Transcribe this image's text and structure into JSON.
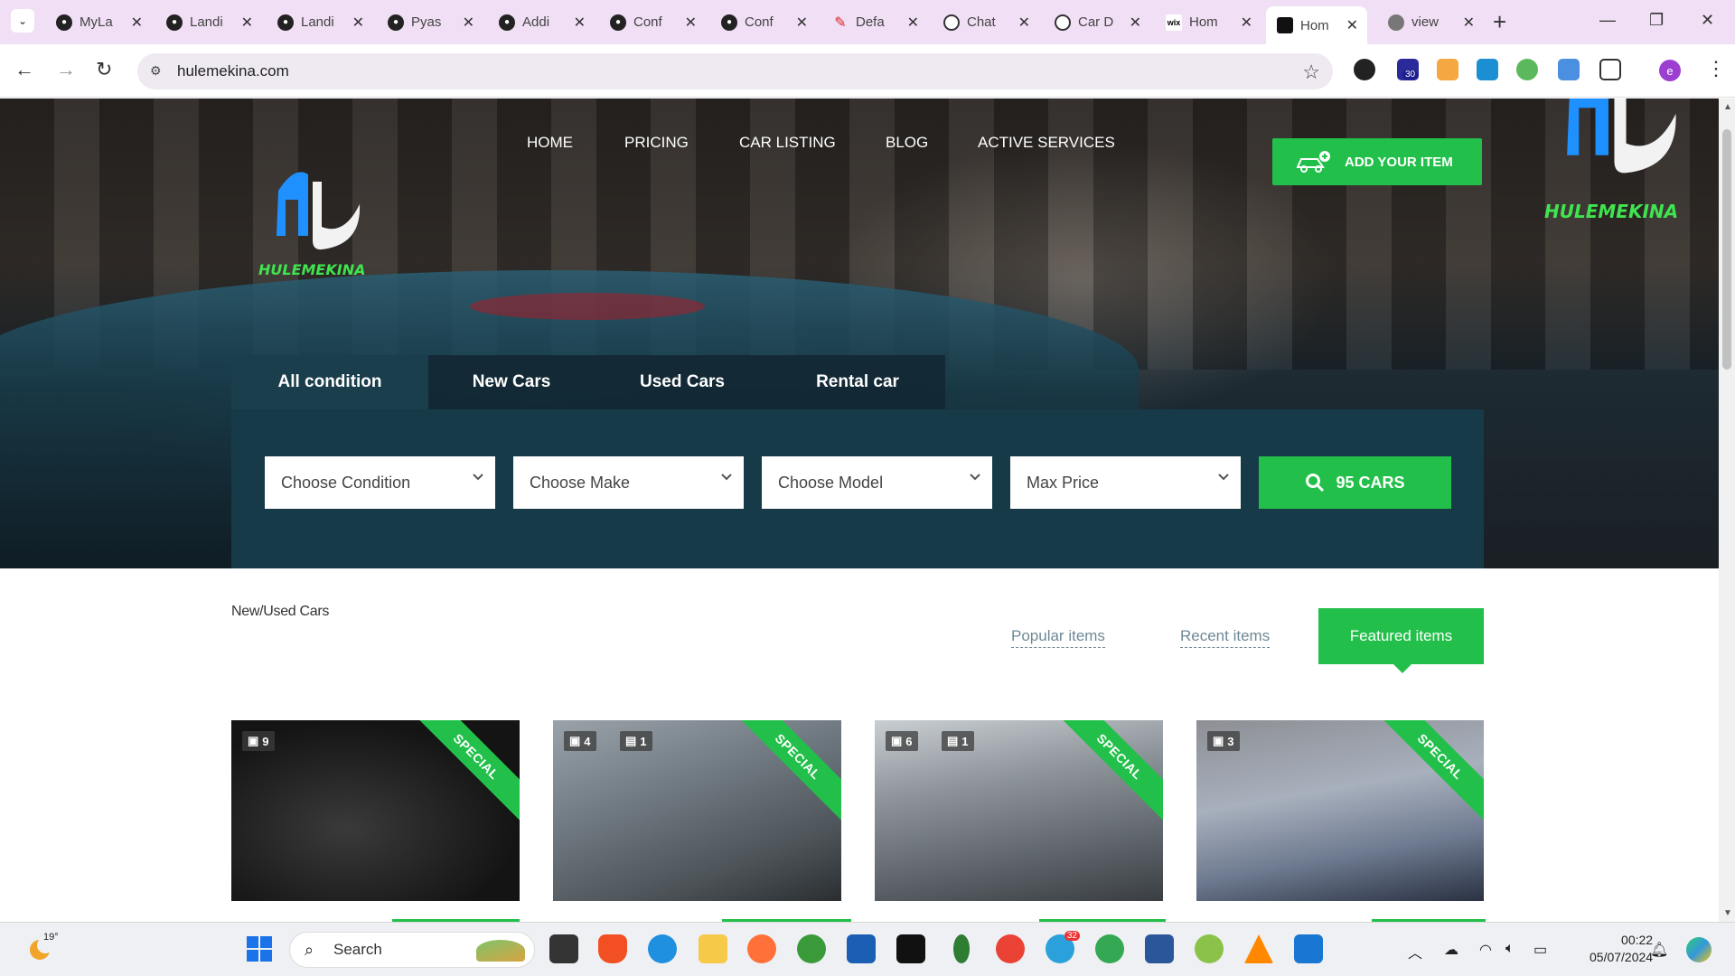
{
  "browser": {
    "tabs": [
      {
        "title": "MyLa",
        "icon": "github-icon"
      },
      {
        "title": "Landi",
        "icon": "github-icon"
      },
      {
        "title": "Landi",
        "icon": "github-icon"
      },
      {
        "title": "Pyas",
        "icon": "github-icon"
      },
      {
        "title": "Addi",
        "icon": "github-icon"
      },
      {
        "title": "Conf",
        "icon": "github-icon"
      },
      {
        "title": "Conf",
        "icon": "github-icon"
      },
      {
        "title": "Defa",
        "icon": "pen-icon"
      },
      {
        "title": "Chat",
        "icon": "openai-icon"
      },
      {
        "title": "Car D",
        "icon": "openai-icon"
      },
      {
        "title": "Hom",
        "icon": "wix-icon"
      },
      {
        "title": "Hom",
        "icon": "hulemekina-icon",
        "active": true
      },
      {
        "title": "view",
        "icon": "globe-icon"
      }
    ],
    "url": "hulemekina.com",
    "extension_badge": "30",
    "profile_initial": "e"
  },
  "site": {
    "brand_name": "HULEMEKINA",
    "nav": [
      "HOME",
      "PRICING",
      "CAR LISTING",
      "BLOG",
      "ACTIVE SERVICES"
    ],
    "add_item_label": "ADD YOUR ITEM",
    "search_tabs": [
      "All condition",
      "New Cars",
      "Used Cars",
      "Rental car"
    ],
    "active_search_tab": "All condition",
    "selects": [
      "Choose Condition",
      "Choose Make",
      "Choose Model",
      "Max Price"
    ],
    "search_button_label": "95 CARS",
    "section_title": "New/Used Cars",
    "filters": [
      "Popular items",
      "Recent items",
      "Featured items"
    ],
    "active_filter": "Featured items",
    "ribbon_label": "SPECIAL",
    "listings": [
      {
        "photos": "9",
        "videos": null
      },
      {
        "photos": "4",
        "videos": "1"
      },
      {
        "photos": "6",
        "videos": "1"
      },
      {
        "photos": "3",
        "videos": null
      }
    ]
  },
  "colors": {
    "accent_green": "#22c04a",
    "brand_blue": "#1e90ff",
    "search_panel": "#163a48"
  },
  "taskbar": {
    "temperature": "19°",
    "search_placeholder": "Search",
    "telegram_badge": "32",
    "time": "00:22",
    "date": "05/07/2024"
  }
}
